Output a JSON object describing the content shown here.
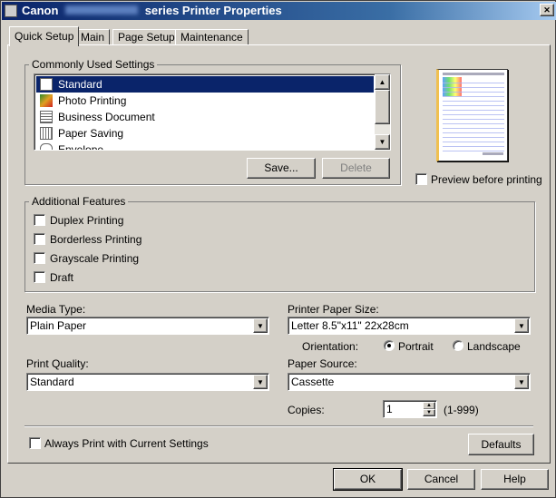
{
  "window": {
    "title": "Canon ██████ series Printer Properties",
    "title_prefix": "Canon",
    "title_suffix": "series Printer Properties",
    "close_label": "✕"
  },
  "tabs": [
    {
      "label": "Quick Setup",
      "active": true
    },
    {
      "label": "Main"
    },
    {
      "label": "Page Setup"
    },
    {
      "label": "Maintenance"
    }
  ],
  "common": {
    "label": "Commonly Used Settings",
    "items": [
      {
        "label": "Standard",
        "selected": true,
        "icon": "standard-icon"
      },
      {
        "label": "Photo Printing",
        "icon": "photo-icon"
      },
      {
        "label": "Business Document",
        "icon": "document-icon"
      },
      {
        "label": "Paper Saving",
        "icon": "paper-saving-icon"
      },
      {
        "label": "Envelope",
        "icon": "envelope-icon"
      }
    ],
    "save_label": "Save...",
    "delete_label": "Delete"
  },
  "preview": {
    "label": "Preview before printing",
    "checked": false
  },
  "features": {
    "label": "Additional Features",
    "items": [
      {
        "label": "Duplex Printing"
      },
      {
        "label": "Borderless Printing"
      },
      {
        "label": "Grayscale Printing"
      },
      {
        "label": "Draft"
      }
    ]
  },
  "media_type": {
    "label": "Media Type:",
    "value": "Plain Paper"
  },
  "paper_size": {
    "label": "Printer Paper Size:",
    "value": "Letter 8.5\"x11\" 22x28cm"
  },
  "orientation": {
    "label": "Orientation:",
    "portrait": "Portrait",
    "landscape": "Landscape",
    "selected": "Portrait"
  },
  "print_quality": {
    "label": "Print Quality:",
    "value": "Standard"
  },
  "paper_source": {
    "label": "Paper Source:",
    "value": "Cassette"
  },
  "copies": {
    "label": "Copies:",
    "value": "1",
    "range": "(1-999)"
  },
  "always_print": {
    "label": "Always Print with Current Settings",
    "checked": false
  },
  "buttons": {
    "defaults": "Defaults",
    "ok": "OK",
    "cancel": "Cancel",
    "help": "Help"
  }
}
